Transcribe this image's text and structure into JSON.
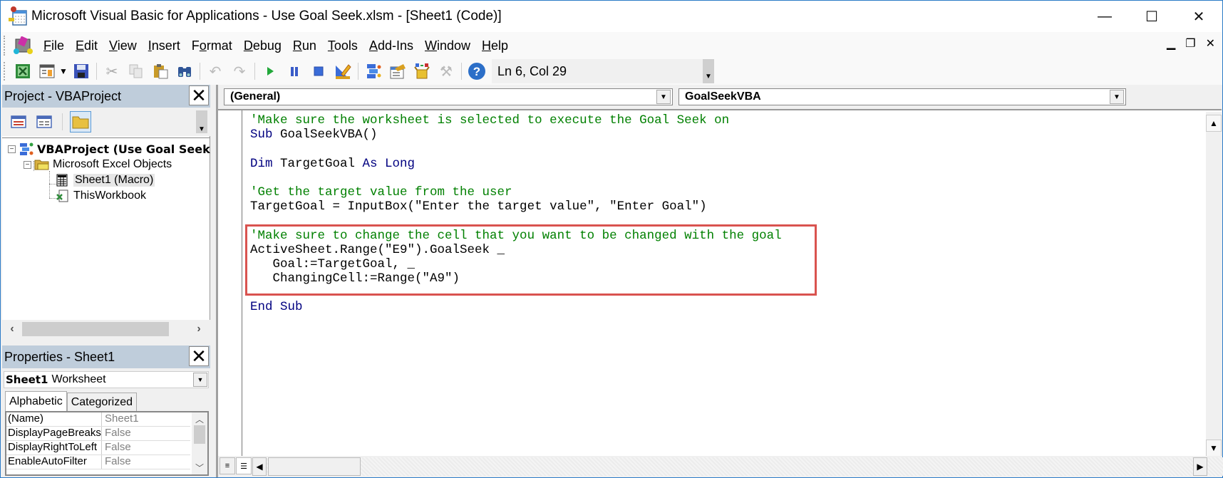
{
  "window": {
    "title": "Microsoft Visual Basic for Applications - Use Goal Seek.xlsm - [Sheet1 (Code)]",
    "controls": {
      "minimize": "—",
      "maximize": "☐",
      "close": "✕"
    },
    "mdi_controls": {
      "minimize": "▁",
      "restore": "❐",
      "close": "✕"
    }
  },
  "menu": {
    "items": [
      {
        "label": "File",
        "accel": "F"
      },
      {
        "label": "Edit",
        "accel": "E"
      },
      {
        "label": "View",
        "accel": "V"
      },
      {
        "label": "Insert",
        "accel": "I"
      },
      {
        "label": "Format",
        "accel": "o"
      },
      {
        "label": "Debug",
        "accel": "D"
      },
      {
        "label": "Run",
        "accel": "R"
      },
      {
        "label": "Tools",
        "accel": "T"
      },
      {
        "label": "Add-Ins",
        "accel": "A"
      },
      {
        "label": "Window",
        "accel": "W"
      },
      {
        "label": "Help",
        "accel": "H"
      }
    ]
  },
  "toolbar": {
    "status": "Ln 6, Col 29",
    "buttons": [
      "view-excel",
      "insert-userform",
      "save",
      "cut",
      "copy",
      "paste",
      "find",
      "undo",
      "redo",
      "run",
      "break",
      "reset",
      "design-mode",
      "project-explorer",
      "properties-window",
      "object-browser",
      "toolbox",
      "help"
    ]
  },
  "project_panel": {
    "title": "Project - VBAProject",
    "close": "✕",
    "tree": [
      {
        "label": "VBAProject (Use Goal Seek.xlsm)",
        "level": 0,
        "expander": "−"
      },
      {
        "label": "Microsoft Excel Objects",
        "level": 1,
        "expander": "−"
      },
      {
        "label": "Sheet1 (Macro)",
        "level": 2,
        "selected": true
      },
      {
        "label": "ThisWorkbook",
        "level": 2
      }
    ],
    "scroll_left": "‹",
    "scroll_right": "›"
  },
  "properties_panel": {
    "title": "Properties - Sheet1",
    "close": "✕",
    "object_name": "Sheet1",
    "object_type": "Worksheet",
    "tabs": [
      {
        "label": "Alphabetic",
        "active": true
      },
      {
        "label": "Categorized",
        "active": false
      }
    ],
    "rows": [
      {
        "name": "(Name)",
        "value": "Sheet1"
      },
      {
        "name": "DisplayPageBreaks",
        "value": "False"
      },
      {
        "name": "DisplayRightToLeft",
        "value": "False"
      },
      {
        "name": "EnableAutoFilter",
        "value": "False"
      }
    ]
  },
  "code_window": {
    "object_combo": "(General)",
    "procedure_combo": "GoalSeekVBA",
    "colors": {
      "comment": "#008000",
      "keyword": "#000080",
      "highlight": "#d9534f"
    },
    "lines": [
      {
        "type": "comment",
        "text": "'Make sure the worksheet is selected to execute the Goal Seek on"
      },
      {
        "type": "mixed",
        "parts": [
          {
            "k": "kw",
            "t": "Sub"
          },
          {
            "k": "",
            "t": " GoalSeekVBA()"
          }
        ]
      },
      {
        "type": "blank",
        "text": ""
      },
      {
        "type": "mixed",
        "parts": [
          {
            "k": "kw",
            "t": "Dim"
          },
          {
            "k": "",
            "t": " TargetGoal "
          },
          {
            "k": "kw",
            "t": "As Long"
          }
        ]
      },
      {
        "type": "blank",
        "text": ""
      },
      {
        "type": "comment",
        "text": "'Get the target value from the user"
      },
      {
        "type": "plain",
        "text": "TargetGoal = InputBox(\"Enter the target value\", \"Enter Goal\")"
      },
      {
        "type": "blank",
        "text": ""
      },
      {
        "type": "comment",
        "text": "'Make sure to change the cell that you want to be changed with the goal"
      },
      {
        "type": "plain",
        "text": "ActiveSheet.Range(\"E9\").GoalSeek _"
      },
      {
        "type": "plain",
        "text": "   Goal:=TargetGoal, _"
      },
      {
        "type": "plain",
        "text": "   ChangingCell:=Range(\"A9\")"
      },
      {
        "type": "blank",
        "text": ""
      },
      {
        "type": "mixed",
        "parts": [
          {
            "k": "kw",
            "t": "End Sub"
          }
        ]
      }
    ]
  }
}
